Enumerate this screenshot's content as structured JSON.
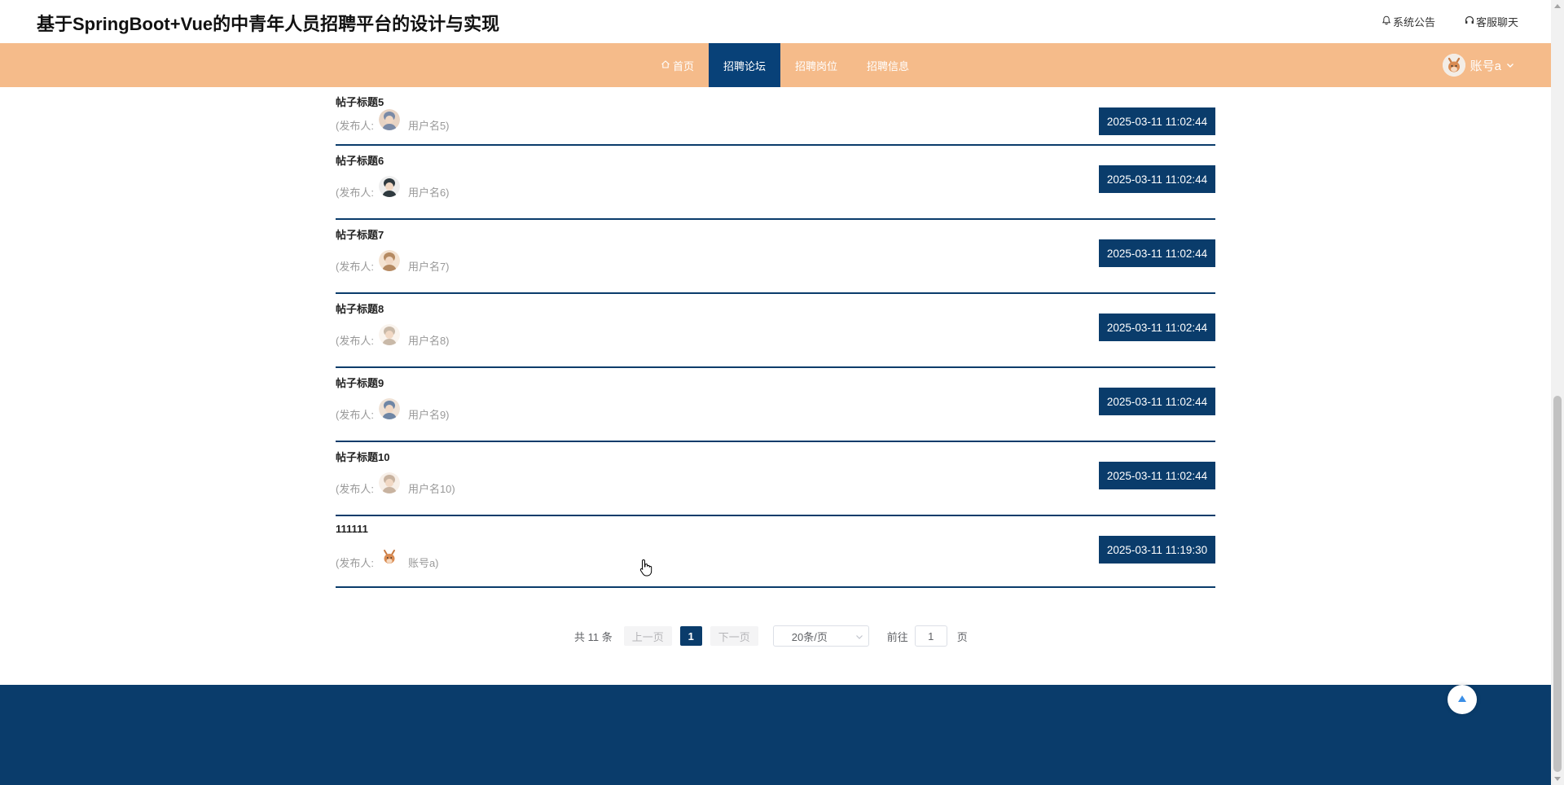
{
  "header": {
    "title": "基于SpringBoot+Vue的中青年人员招聘平台的设计与实现",
    "links": [
      {
        "label": "系统公告",
        "icon": "bell-icon"
      },
      {
        "label": "客服聊天",
        "icon": "headset-icon"
      }
    ]
  },
  "nav": {
    "items": [
      {
        "label": "首页",
        "icon": "home-icon",
        "active": false
      },
      {
        "label": "招聘论坛",
        "active": true
      },
      {
        "label": "招聘岗位",
        "active": false
      },
      {
        "label": "招聘信息",
        "active": false
      }
    ],
    "account": "账号a"
  },
  "posts": [
    {
      "title": "帖子标题5",
      "publisher_prefix": "(发布人:",
      "user": "用户名5)",
      "time": "2025-03-11 11:02:44"
    },
    {
      "title": "帖子标题6",
      "publisher_prefix": "(发布人:",
      "user": "用户名6)",
      "time": "2025-03-11 11:02:44"
    },
    {
      "title": "帖子标题7",
      "publisher_prefix": "(发布人:",
      "user": "用户名7)",
      "time": "2025-03-11 11:02:44"
    },
    {
      "title": "帖子标题8",
      "publisher_prefix": "(发布人:",
      "user": "用户名8)",
      "time": "2025-03-11 11:02:44"
    },
    {
      "title": "帖子标题9",
      "publisher_prefix": "(发布人:",
      "user": "用户名9)",
      "time": "2025-03-11 11:02:44"
    },
    {
      "title": "帖子标题10",
      "publisher_prefix": "(发布人:",
      "user": "用户名10)",
      "time": "2025-03-11 11:02:44"
    },
    {
      "title": "111111",
      "publisher_prefix": "(发布人:",
      "user": "账号a)",
      "time": "2025-03-11 11:19:30"
    }
  ],
  "pagination": {
    "total": "共 11 条",
    "prev": "上一页",
    "current": "1",
    "next": "下一页",
    "page_size": "20条/页",
    "goto_label": "前往",
    "goto_value": "1",
    "page_unit": "页"
  },
  "colors": {
    "nav_bg": "#f5bb8a",
    "primary": "#0a3c6b",
    "nav_active": "#084178"
  }
}
